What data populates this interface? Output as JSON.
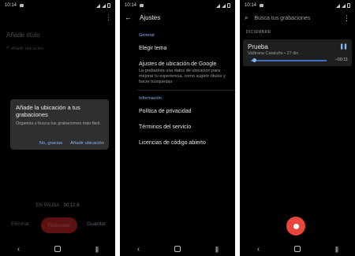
{
  "status_time": "10:14",
  "screen1": {
    "title_placeholder": "Añade título",
    "location_placeholder": "Añadir ubicación",
    "dialog": {
      "title": "Añade la ubicación a tus grabaciones",
      "body": "Organiza y busca tus grabaciones más fácil.",
      "dismiss_label": "No, gracias",
      "confirm_label": "Añadir ubicación"
    },
    "paused_label": "EN PAUSA",
    "elapsed": "00:12.6",
    "delete_label": "Eliminar",
    "resume_label": "Reanudar",
    "save_label": "Guardar"
  },
  "screen2": {
    "title": "Ajustes",
    "general_header": "General",
    "theme_label": "Elegir tema",
    "location_title": "Ajustes de ubicación de Google",
    "location_desc": "La grabadora usa datos de ubicación para mejorar tu experiencia, como sugerir títulos y hacer búsquedas",
    "info_header": "Información",
    "privacy_label": "Política de privacidad",
    "terms_label": "Términos del servicio",
    "licenses_label": "Licencias de código abierto"
  },
  "screen3": {
    "search_placeholder": "Busca tus grabaciones",
    "month_header": "DICIEMBRE",
    "recording": {
      "name": "Prueba",
      "meta": "Vallirana Cataluña • 27 dic.",
      "remaining": "−00:11",
      "progress": 0.05
    }
  },
  "colors": {
    "accent": "#8ab4f8",
    "record": "#e8453c",
    "background": "#000000"
  }
}
